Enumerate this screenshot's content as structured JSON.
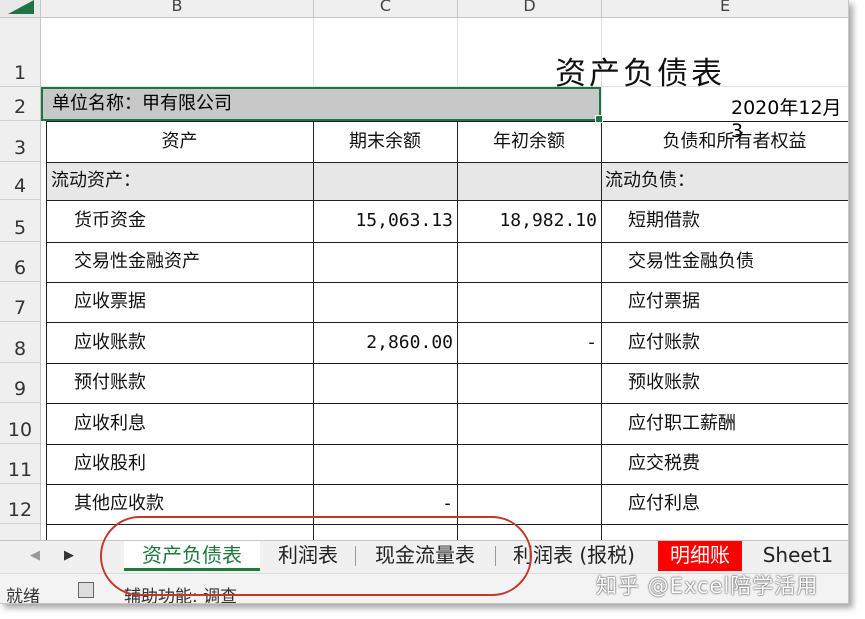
{
  "columns": [
    "B",
    "C",
    "D",
    "E"
  ],
  "rows": [
    "1",
    "2",
    "3",
    "4",
    "5",
    "6",
    "7",
    "8",
    "9",
    "10",
    "11",
    "12"
  ],
  "sheet": {
    "title": "资产负债表",
    "unit_label": "单位名称：甲有限公司",
    "date": "2020年12月3",
    "headers": {
      "assets": "资产",
      "end_balance": "期末余额",
      "begin_balance": "年初余额",
      "liabilities": "负债和所有者权益"
    },
    "current_assets": "流动资产：",
    "current_liabilities": "流动负债：",
    "assets_items": [
      {
        "label": "货币资金",
        "end": "15,063.13",
        "begin": "18,982.10"
      },
      {
        "label": "交易性金融资产",
        "end": "",
        "begin": ""
      },
      {
        "label": "应收票据",
        "end": "",
        "begin": ""
      },
      {
        "label": "应收账款",
        "end": "2,860.00",
        "begin": "-"
      },
      {
        "label": "预付账款",
        "end": "",
        "begin": ""
      },
      {
        "label": "应收利息",
        "end": "",
        "begin": ""
      },
      {
        "label": "应收股利",
        "end": "",
        "begin": ""
      },
      {
        "label": "其他应收款",
        "end": "-",
        "begin": ""
      }
    ],
    "liability_items": [
      "短期借款",
      "交易性金融负债",
      "应付票据",
      "应付账款",
      "预收账款",
      "应付职工薪酬",
      "应交税费",
      "应付利息"
    ]
  },
  "tabs": [
    {
      "label": "资产负债表",
      "active": true
    },
    {
      "label": "利润表"
    },
    {
      "label": "现金流量表"
    },
    {
      "label": "利润表 (报税)"
    },
    {
      "label": "明细账",
      "highlight": "#ff0000"
    },
    {
      "label": "Sheet1"
    }
  ],
  "status": {
    "ready": "就绪",
    "accessibility": "辅助功能: 调查"
  },
  "watermark": "知乎 @Excel陪学活用",
  "colors": {
    "accent": "#217346",
    "tab_active": "#1e7a3c",
    "annotation": "#c0392b",
    "highlight_tab": "#ff0000"
  }
}
